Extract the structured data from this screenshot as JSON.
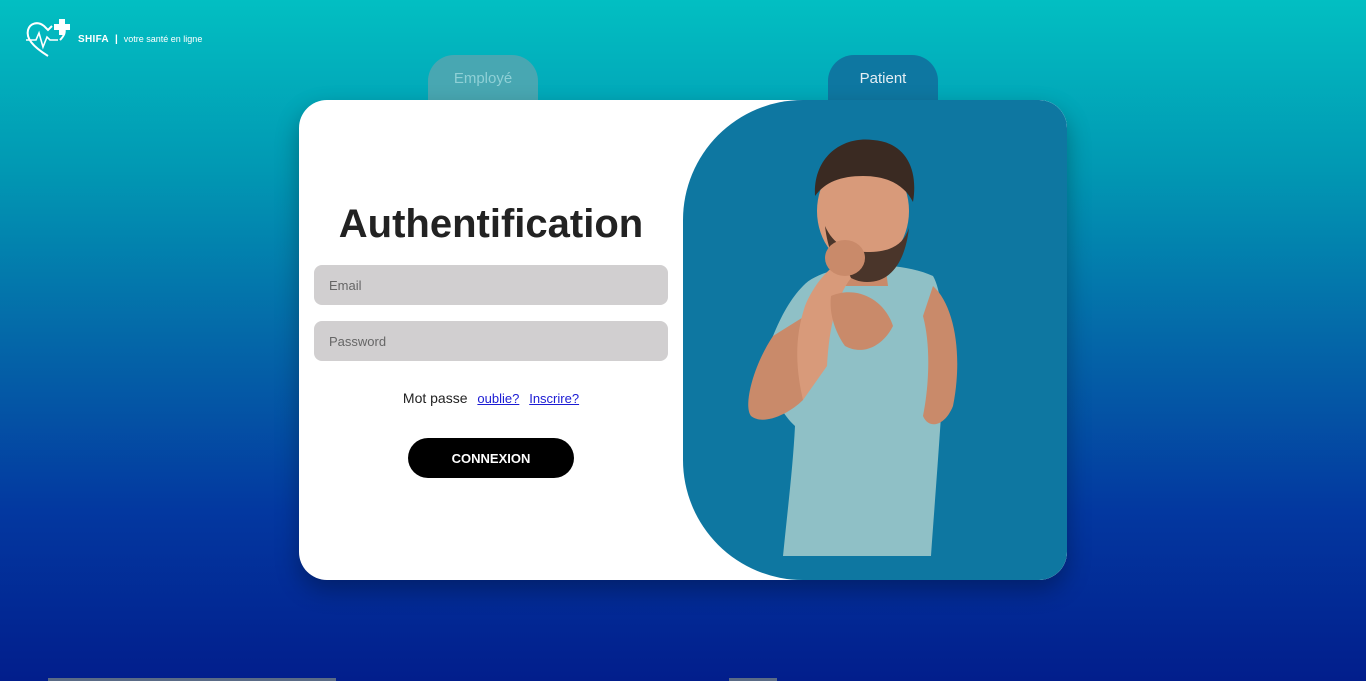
{
  "header": {
    "brand": "SHIFA",
    "separator": "|",
    "tagline": "votre santé en ligne",
    "logo_icon": "heart-pulse-cross-icon"
  },
  "tabs": [
    {
      "label": "Employé",
      "active": false
    },
    {
      "label": "Patient",
      "active": true
    }
  ],
  "form": {
    "title": "Authentification",
    "email_placeholder": "Email",
    "password_placeholder": "Password",
    "forgot_prefix": "Mot passe",
    "forgot_link": "oublie?",
    "register_link": "Inscrire?",
    "submit_label": "CONNEXION"
  },
  "colors": {
    "panel": "#0e77a1",
    "button": "#000000",
    "field": "#d1cfd0"
  }
}
